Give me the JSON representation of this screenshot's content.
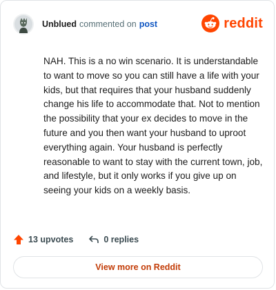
{
  "comment": {
    "username": "Unblued",
    "action": "commented on",
    "post_link": "post",
    "brand": "reddit",
    "body": "NAH. This is a no win scenario. It is understandable to want to move so you can still have a life with your kids, but that requires that your husband suddenly change his life to accommodate that. Not to mention the possibility that your ex decides to move in the future and you then want your husband to uproot everything again. Your husband is perfectly reasonable to want to stay with the current town, job, and lifestyle, but it only works if you give up on seeing your kids on a weekly basis.",
    "upvotes": "13 upvotes",
    "replies": "0 replies",
    "view_more": "View more on Reddit"
  },
  "colors": {
    "accent": "#ff4500",
    "link": "#0f56c2"
  }
}
